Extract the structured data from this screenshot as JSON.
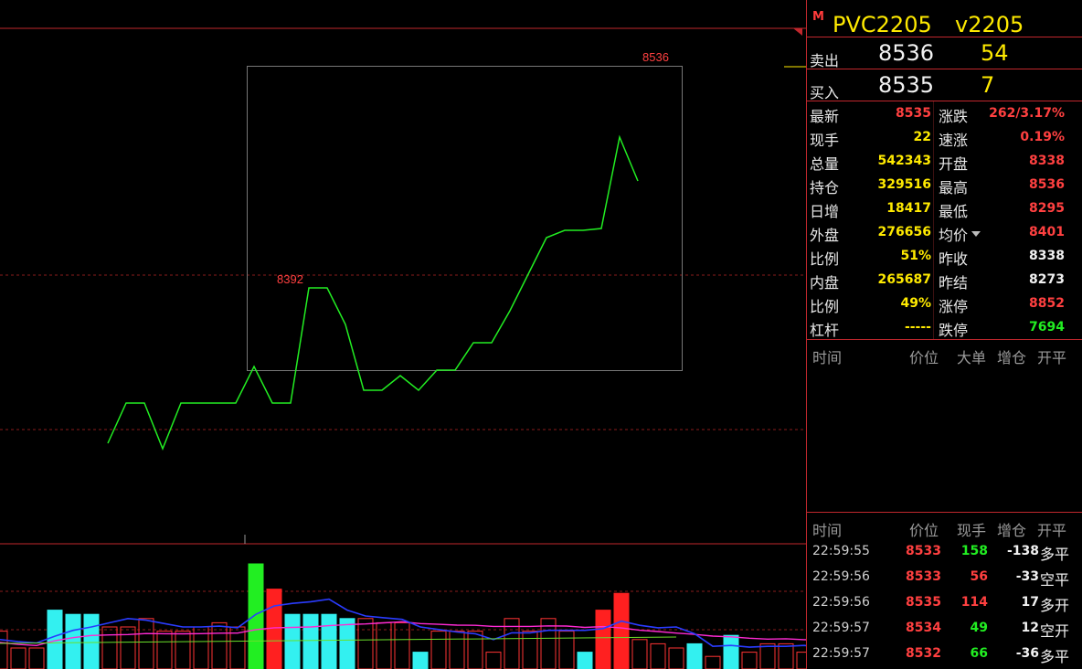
{
  "title": {
    "badge": "M",
    "name": "PVC2205",
    "code": "v2205"
  },
  "quotes": [
    {
      "label": "卖出",
      "price": "8536",
      "vol": "54"
    },
    {
      "label": "买入",
      "price": "8535",
      "vol": "7"
    }
  ],
  "stats_left": [
    {
      "label": "最新",
      "value": "8535",
      "color": "#ff4040"
    },
    {
      "label": "现手",
      "value": "22",
      "color": "#ffea00"
    },
    {
      "label": "总量",
      "value": "542343",
      "color": "#ffea00"
    },
    {
      "label": "持仓",
      "value": "329516",
      "color": "#ffea00"
    },
    {
      "label": "日增",
      "value": "18417",
      "color": "#ffea00"
    },
    {
      "label": "外盘",
      "value": "276656",
      "color": "#ffea00"
    },
    {
      "label": "比例",
      "value": "51%",
      "color": "#ffea00"
    },
    {
      "label": "内盘",
      "value": "265687",
      "color": "#ffea00"
    },
    {
      "label": "比例",
      "value": "49%",
      "color": "#ffea00"
    },
    {
      "label": "杠杆",
      "value": "-----",
      "color": "#ffea00"
    }
  ],
  "stats_right": [
    {
      "label": "涨跌",
      "value": "262/3.17%",
      "color": "#ff4040"
    },
    {
      "label": "速涨",
      "value": "0.19%",
      "color": "#ff4040"
    },
    {
      "label": "开盘",
      "value": "8338",
      "color": "#ff4040"
    },
    {
      "label": "最高",
      "value": "8536",
      "color": "#ff4040"
    },
    {
      "label": "最低",
      "value": "8295",
      "color": "#ff4040"
    },
    {
      "label": "均价",
      "value": "8401",
      "color": "#ff4040"
    },
    {
      "label": "昨收",
      "value": "8338",
      "color": "#f2f2f2"
    },
    {
      "label": "昨结",
      "value": "8273",
      "color": "#f2f2f2"
    },
    {
      "label": "涨停",
      "value": "8852",
      "color": "#ff4040"
    },
    {
      "label": "跌停",
      "value": "7694",
      "color": "#22ee22"
    }
  ],
  "big_order_header": {
    "time": "时间",
    "price": "价位",
    "big": "大单",
    "oi": "增仓",
    "type": "开平"
  },
  "trade_header": {
    "time": "时间",
    "price": "价位",
    "vol": "现手",
    "oi": "增仓",
    "type": "开平"
  },
  "trades": [
    {
      "time": "22:59:55",
      "price": "8533",
      "price_color": "#ff4040",
      "vol": "158",
      "vol_color": "#22ee22",
      "oi": "-138",
      "type": "多平"
    },
    {
      "time": "22:59:56",
      "price": "8533",
      "price_color": "#ff4040",
      "vol": "56",
      "vol_color": "#ff4040",
      "oi": "-33",
      "type": "空平"
    },
    {
      "time": "22:59:56",
      "price": "8535",
      "price_color": "#ff4040",
      "vol": "114",
      "vol_color": "#ff4040",
      "oi": "17",
      "type": "多开"
    },
    {
      "time": "22:59:57",
      "price": "8534",
      "price_color": "#ff4040",
      "vol": "49",
      "vol_color": "#22ee22",
      "oi": "12",
      "type": "空开"
    },
    {
      "time": "22:59:57",
      "price": "8532",
      "price_color": "#ff4040",
      "vol": "66",
      "vol_color": "#22ee22",
      "oi": "-36",
      "type": "多平"
    }
  ],
  "chart_data": {
    "type": "candlestick",
    "annotations": [
      "8392",
      "8536"
    ],
    "candles": [
      [
        8290,
        8300,
        8285,
        8292
      ],
      [
        8295,
        8328,
        8292,
        8325
      ],
      [
        8305,
        8335,
        8300,
        8330
      ],
      [
        8325,
        8345,
        8320,
        8340
      ],
      [
        8345,
        8355,
        8320,
        8335
      ],
      [
        8335,
        8345,
        8315,
        8328
      ],
      [
        8328,
        8342,
        8308,
        8310
      ],
      [
        8312,
        8318,
        8302,
        8308
      ],
      [
        8312,
        8358,
        8310,
        8350
      ],
      [
        8355,
        8370,
        8350,
        8368
      ],
      [
        8360,
        8375,
        8355,
        8370
      ],
      [
        8368,
        8378,
        8362,
        8371
      ],
      [
        8367,
        8405,
        8360,
        8398
      ],
      [
        8395,
        8420,
        8350,
        8382
      ],
      [
        8408,
        8475,
        8360,
        8462
      ],
      [
        8452,
        8490,
        8430,
        8422
      ],
      [
        8456,
        8462,
        8400,
        8440
      ],
      [
        8440,
        8450,
        8372,
        8370
      ],
      [
        8384,
        8390,
        8356,
        8376
      ],
      [
        8372,
        8380,
        8356,
        8363
      ],
      [
        8383,
        8390,
        8370,
        8352
      ],
      [
        8372,
        8382,
        8368,
        8384
      ],
      [
        8383,
        8395,
        8370,
        8376
      ],
      [
        8378,
        8442,
        8375,
        8425
      ],
      [
        8392,
        8412,
        8388,
        8405
      ],
      [
        8405,
        8415,
        8390,
        8408
      ],
      [
        8395,
        8408,
        8385,
        8400
      ],
      [
        8430,
        8440,
        8408,
        8411
      ],
      [
        8410,
        8445,
        8405,
        8440
      ],
      [
        8410,
        8490,
        8405,
        8470
      ],
      [
        8450,
        8515,
        8445,
        8488
      ],
      [
        8478,
        8490,
        8460,
        8470
      ],
      [
        8475,
        8520,
        8470,
        8510
      ],
      [
        8490,
        8530,
        8480,
        8500
      ],
      [
        8495,
        8530,
        8490,
        8488
      ],
      [
        8518,
        8530,
        8495,
        8505
      ],
      [
        8488,
        8520,
        8488,
        8489
      ],
      [
        8509,
        8530,
        8505,
        8521
      ],
      [
        8524,
        8538,
        8505,
        8531
      ],
      [
        8535,
        8536,
        8505,
        8535
      ]
    ],
    "volumes": [
      6,
      6,
      9,
      5,
      5,
      14,
      13,
      13,
      10,
      10,
      12,
      9,
      9,
      10,
      11,
      10,
      25,
      19,
      13,
      13,
      13,
      12,
      12,
      11,
      11,
      4,
      9,
      9,
      9,
      4,
      12,
      9,
      12,
      9,
      4,
      14,
      18,
      7,
      6,
      5,
      6,
      3,
      8,
      4,
      6,
      6,
      4,
      6,
      13,
      7,
      7
    ]
  }
}
